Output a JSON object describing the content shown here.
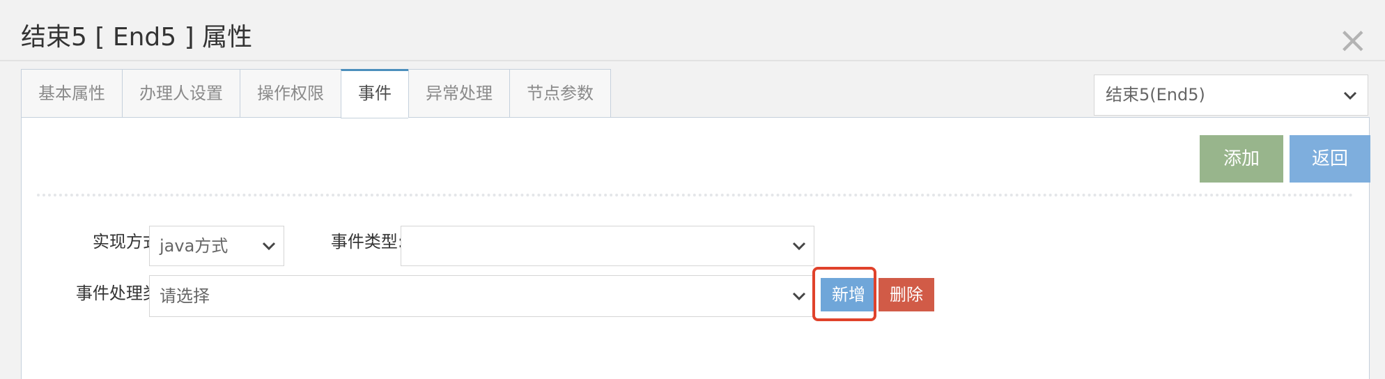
{
  "dialog": {
    "title": "结束5 [ End5 ] 属性",
    "close_label": "×"
  },
  "tabs": [
    {
      "label": "基本属性",
      "active": false
    },
    {
      "label": "办理人设置",
      "active": false
    },
    {
      "label": "操作权限",
      "active": false
    },
    {
      "label": "事件",
      "active": true
    },
    {
      "label": "异常处理",
      "active": false
    },
    {
      "label": "节点参数",
      "active": false
    }
  ],
  "node_select": {
    "value": "结束5(End5)"
  },
  "toolbar": {
    "add_label": "添加",
    "back_label": "返回"
  },
  "form": {
    "impl_label": "实现方式:",
    "impl_value": "java方式",
    "event_type_label": "事件类型:",
    "event_type_value": "",
    "handler_label": "事件处理类:",
    "handler_value": "请选择",
    "new_label": "新增",
    "delete_label": "删除"
  },
  "colors": {
    "add_button": "#98b58c",
    "back_button": "#7eaedd",
    "new_button": "#6fa6d9",
    "delete_button": "#d15b47",
    "highlight": "#e0422b",
    "active_tab_accent": "#4c8fbd"
  }
}
